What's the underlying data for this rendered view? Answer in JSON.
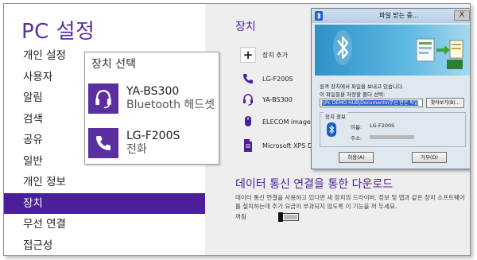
{
  "left": {
    "title": "PC 설정",
    "nav": [
      {
        "label": "개인 설정"
      },
      {
        "label": "사용자"
      },
      {
        "label": "알림"
      },
      {
        "label": "검색"
      },
      {
        "label": "공유"
      },
      {
        "label": "일반"
      },
      {
        "label": "개인 정보"
      },
      {
        "label": "장치",
        "active": true
      },
      {
        "label": "무선 연결"
      },
      {
        "label": "접근성"
      }
    ]
  },
  "right": {
    "section_title": "장치",
    "devices": [
      {
        "icon": "plus-icon",
        "label": "장치 추가"
      },
      {
        "icon": "phone-icon",
        "label": "LG-F200S"
      },
      {
        "icon": "headset-icon",
        "label": "YA-BS300"
      },
      {
        "icon": "mouse-icon",
        "label": "ELECOM image ser"
      },
      {
        "icon": "document-icon",
        "label": "Microsoft XPS Doc"
      }
    ],
    "download_title": "데이터 통신 연결을 통한 다운로드",
    "download_desc": "데이터 통신 연결을 사용하고 있다면 새 장치의 드라이버, 정보 및 앱과 같은 장치 소프트웨어를 설치하는데 추가 요금이 부과되지 않도록 이 기능을 꺼 두세요.",
    "toggle_label": "꺼짐",
    "toggle_state": "off"
  },
  "popup": {
    "title": "장치 선택",
    "items": [
      {
        "icon": "headset-icon",
        "name": "YA-BS300",
        "sub": "Bluetooth 헤드셋"
      },
      {
        "icon": "phone-icon",
        "name": "LG-F200S",
        "sub": "전화"
      }
    ]
  },
  "dialog": {
    "title": "파일 받는 중...",
    "close": "X",
    "line1": "원격 장치에서 파일을 보내고 있습니다.",
    "line2": "이 파일들을 저장할 폴더 선택:",
    "path": "\\\\Pc DEMO HUB\\Documents\\무선 받은 파일",
    "browse": "찾아보기(B)...",
    "info_title": "장치 정보",
    "name_label": "이름:",
    "name_value": "LG-F200S",
    "addr_label": "주소:",
    "accept": "허용(A)",
    "deny": "거부(D)"
  },
  "colors": {
    "accent": "#4b1f9a",
    "tile": "#5b2fa0",
    "right_bg": "#eeeeee"
  }
}
